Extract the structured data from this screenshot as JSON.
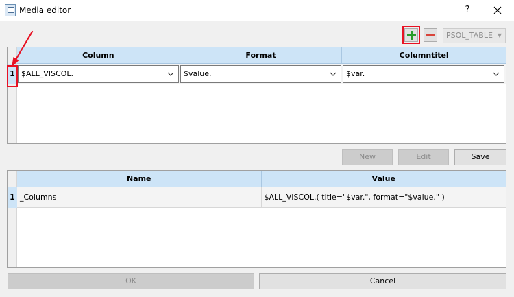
{
  "window": {
    "title": "Media editor",
    "help_label": "?"
  },
  "toolbar": {
    "table_select": "PSOL_TABLE"
  },
  "icons": {
    "add": "plus-icon",
    "remove": "minus-icon",
    "close": "close-icon",
    "dropdown": "chevron-down-icon",
    "annotation": "red-arrow"
  },
  "colors": {
    "accent": "#e81123",
    "header_bg": "#cde4f7",
    "add_green": "#2a9d2a",
    "remove_red": "#d9443a"
  },
  "columns_grid": {
    "headers": [
      "Column",
      "Format",
      "Columntitel"
    ],
    "rows": [
      {
        "num": "1",
        "cells": [
          "$ALL_VISCOL.",
          "$value.",
          "$var."
        ]
      }
    ]
  },
  "actions": {
    "new_label": "New",
    "edit_label": "Edit",
    "save_label": "Save"
  },
  "values_grid": {
    "headers": [
      "Name",
      "Value"
    ],
    "rows": [
      {
        "num": "1",
        "cells": [
          "_Columns",
          "$ALL_VISCOL.( title=\"$var.\", format=\"$value.\" )"
        ]
      }
    ]
  },
  "footer": {
    "ok_label": "OK",
    "cancel_label": "Cancel"
  }
}
